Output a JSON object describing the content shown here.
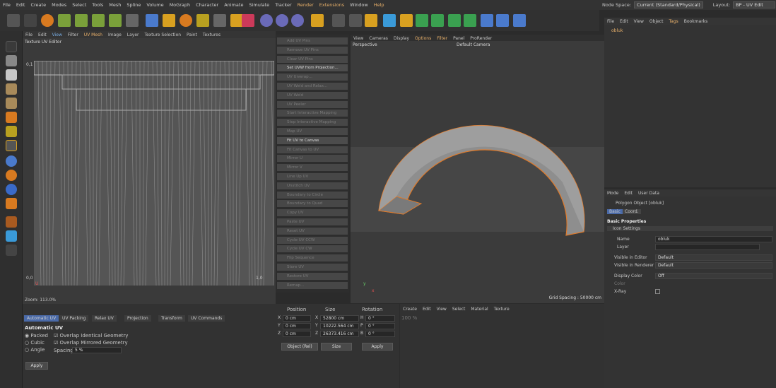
{
  "menu": [
    "File",
    "Edit",
    "Create",
    "Modes",
    "Select",
    "Tools",
    "Mesh",
    "Spline",
    "Volume",
    "MoGraph",
    "Character",
    "Animate",
    "Simulate",
    "Tracker",
    "Render",
    "Extensions",
    "Window",
    "Help"
  ],
  "top_right": {
    "node_space_label": "Node Space:",
    "node_space_value": "Current (Standard/Physical)",
    "layout_label": "Layout:",
    "layout_value": "BP - UV Edit"
  },
  "uv_editor": {
    "menu": [
      "File",
      "Edit",
      "View",
      "Filter",
      "UV Mesh",
      "Image",
      "Layer",
      "Texture Selection",
      "Paint",
      "Textures"
    ],
    "title": "Texture UV Editor",
    "label_top": "0,1",
    "label_bottom_left": "0,0",
    "label_bottom_right": "1,0",
    "label_u": "U",
    "zoom": "Zoom: 113.0%"
  },
  "commands": [
    {
      "label": "Add UV Pins",
      "on": false
    },
    {
      "label": "Remove UV Pins",
      "on": false
    },
    {
      "label": "Clear UV Pins",
      "on": false
    },
    {
      "label": "Set UVW from Projection...",
      "on": true
    },
    {
      "label": "UV Unwrap...",
      "on": false
    },
    {
      "label": "UV Weld and Relax...",
      "on": false
    },
    {
      "label": "UV Weld",
      "on": false
    },
    {
      "label": "UV Peeler",
      "on": false
    },
    {
      "label": "Start Interactive Mapping",
      "on": false
    },
    {
      "label": "Stop Interactive Mapping",
      "on": false
    },
    {
      "label": "Map UV",
      "on": false
    },
    {
      "label": "Fit UV to Canvas",
      "on": true
    },
    {
      "label": "Fit Canvas to UV",
      "on": false
    },
    {
      "label": "Mirror U",
      "on": false
    },
    {
      "label": "Mirror V",
      "on": false
    },
    {
      "label": "Line Up UV",
      "on": false
    },
    {
      "label": "Unstitch UV",
      "on": false
    },
    {
      "label": "Boundary to Circle",
      "on": false
    },
    {
      "label": "Boundary to Quad",
      "on": false
    },
    {
      "label": "Copy UV",
      "on": false
    },
    {
      "label": "Paste UV",
      "on": false
    },
    {
      "label": "Reset UV",
      "on": false
    },
    {
      "label": "Cycle UV CCW",
      "on": false
    },
    {
      "label": "Cycle UV CW",
      "on": false
    },
    {
      "label": "Flip Sequence",
      "on": false
    },
    {
      "label": "Store UV",
      "on": false
    },
    {
      "label": "Restore UV",
      "on": false
    },
    {
      "label": "Remap...",
      "on": false
    }
  ],
  "viewport": {
    "menu": [
      "View",
      "Cameras",
      "Display",
      "Options",
      "Filter",
      "Panel",
      "ProRender"
    ],
    "name": "Perspective",
    "camera": "Default Camera",
    "grid": "Grid Spacing : 50000 cm",
    "axis_y": "y",
    "axis_x": "x"
  },
  "object_manager": {
    "menu": [
      "File",
      "Edit",
      "View",
      "Object",
      "Tags",
      "Bookmarks"
    ],
    "object_name": "obluk"
  },
  "attributes": {
    "menu": [
      "Mode",
      "Edit",
      "User Data"
    ],
    "title": "Polygon Object [obluk]",
    "tabs": [
      "Basic",
      "Coord."
    ],
    "section": "Basic Properties",
    "icon_settings": "Icon Settings",
    "name_label": "Name",
    "name_value": "obluk",
    "layer_label": "Layer",
    "vis_editor_label": "Visible in Editor",
    "vis_editor_value": "Default",
    "vis_render_label": "Visible in Renderer",
    "vis_render_value": "Default",
    "display_color_label": "Display Color",
    "display_color_value": "Off",
    "color_label": "Color",
    "xray_label": "X-Ray"
  },
  "uv_bottom": {
    "tabs": [
      "Automatic UV",
      "UV Packing",
      "Relax UV",
      "Projection",
      "Transform",
      "UV Commands"
    ],
    "section": "Automatic UV",
    "packed": "Packed",
    "cubic": "Cubic",
    "angle": "Angle",
    "overlap_identical": "Overlap Identical Geometry",
    "overlap_mirrored": "Overlap Mirrored Geometry",
    "spacing_label": "Spacing",
    "spacing_value": "5 %",
    "apply": "Apply"
  },
  "coords": {
    "headers": [
      "Position",
      "Size",
      "Rotation"
    ],
    "rows": [
      {
        "axis": "X",
        "pos": "0 cm",
        "saxis": "X",
        "size": "52800 cm",
        "raxis": "H",
        "rot": "0 °"
      },
      {
        "axis": "Y",
        "pos": "0 cm",
        "saxis": "Y",
        "size": "10222.564 cm",
        "raxis": "P",
        "rot": "0 °"
      },
      {
        "axis": "Z",
        "pos": "0 cm",
        "saxis": "Z",
        "size": "26373.416 cm",
        "raxis": "B",
        "rot": "0 °"
      }
    ],
    "mode": "Object (Rel)",
    "size_mode": "Size",
    "apply": "Apply"
  },
  "materials": {
    "menu": [
      "Create",
      "Edit",
      "View",
      "Select",
      "Material",
      "Texture"
    ],
    "percent": "100 %"
  },
  "colors": {
    "accent": "#e8b06a",
    "selection": "#e07a2a",
    "panel": "#333333"
  }
}
